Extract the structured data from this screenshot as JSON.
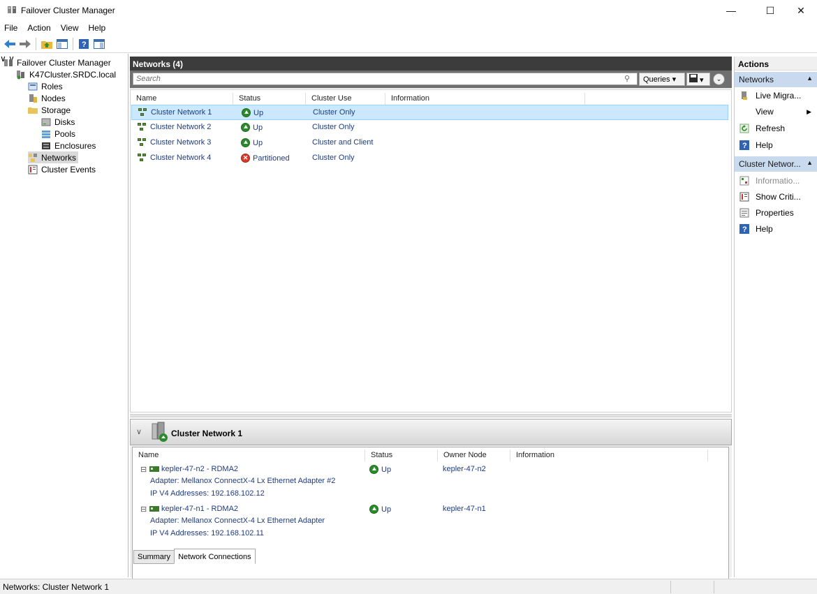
{
  "window": {
    "title": "Failover Cluster Manager",
    "min": "—",
    "max": "☐",
    "close": "✕"
  },
  "menu": [
    "File",
    "Action",
    "View",
    "Help"
  ],
  "tree": {
    "root": "Failover Cluster Manager",
    "cluster": "K47Cluster.SRDC.local",
    "roles": "Roles",
    "nodes": "Nodes",
    "storage": "Storage",
    "disks": "Disks",
    "pools": "Pools",
    "enclosures": "Enclosures",
    "networks": "Networks",
    "events": "Cluster Events"
  },
  "main": {
    "header": "Networks (4)",
    "search_placeholder": "Search",
    "queries": "Queries",
    "columns": [
      "Name",
      "Status",
      "Cluster Use",
      "Information"
    ],
    "rows": [
      {
        "name": "Cluster Network 1",
        "status": "Up",
        "use": "Cluster Only",
        "info": ""
      },
      {
        "name": "Cluster Network 2",
        "status": "Up",
        "use": "Cluster Only",
        "info": ""
      },
      {
        "name": "Cluster Network 3",
        "status": "Up",
        "use": "Cluster and Client",
        "info": ""
      },
      {
        "name": "Cluster Network 4",
        "status": "Partitioned",
        "use": "Cluster Only",
        "info": ""
      }
    ]
  },
  "detail": {
    "title": "Cluster Network 1",
    "columns": [
      "Name",
      "Status",
      "Owner Node",
      "Information"
    ],
    "items": [
      {
        "name": "kepler-47-n2 - RDMA2",
        "adapter": "Adapter: Mellanox ConnectX-4 Lx Ethernet Adapter #2",
        "ip": "IP V4 Addresses: 192.168.102.12",
        "status": "Up",
        "owner": "kepler-47-n2"
      },
      {
        "name": "kepler-47-n1 - RDMA2",
        "adapter": "Adapter: Mellanox ConnectX-4 Lx Ethernet Adapter",
        "ip": "IP V4 Addresses: 192.168.102.11",
        "status": "Up",
        "owner": "kepler-47-n1"
      }
    ],
    "tabs": [
      "Summary",
      "Network Connections"
    ]
  },
  "actions": {
    "header": "Actions",
    "section1": "Networks",
    "live_migration": "Live Migra...",
    "view": "View",
    "refresh": "Refresh",
    "help1": "Help",
    "section2": "Cluster Networ...",
    "information": "Informatio...",
    "show_critical": "Show Criti...",
    "properties": "Properties",
    "help2": "Help"
  },
  "status": "Networks:  Cluster Network 1",
  "colors": {
    "selection": "#cce8ff",
    "header_dark": "#3c3c3c",
    "link_blue": "#1f3b7f",
    "section_blue": "#c9d9ee"
  }
}
